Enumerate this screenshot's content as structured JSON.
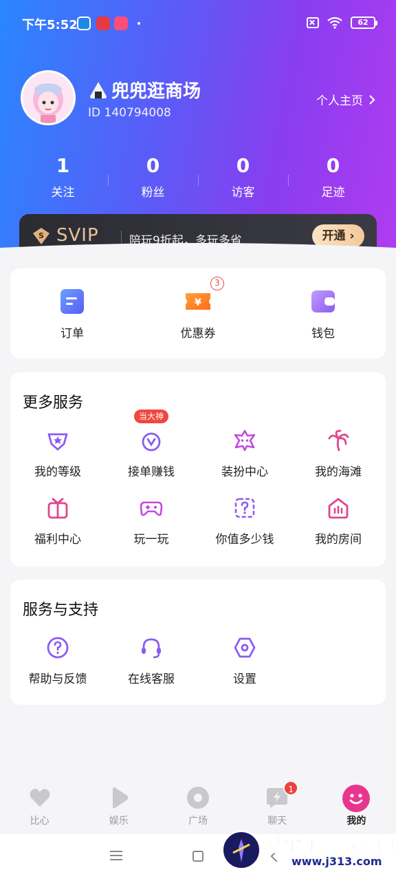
{
  "status_bar": {
    "time": "下午5:52",
    "battery": "62"
  },
  "profile": {
    "nickname": "兜兜逛商场",
    "id_text": "ID 140794008",
    "home_link": "个人主页"
  },
  "stats": [
    {
      "value": "1",
      "label": "关注"
    },
    {
      "value": "0",
      "label": "粉丝"
    },
    {
      "value": "0",
      "label": "访客"
    },
    {
      "value": "0",
      "label": "足迹"
    }
  ],
  "svip": {
    "title": "SVIP",
    "text": "陪玩9折起，多玩多省",
    "button": "开通"
  },
  "quick_actions": [
    {
      "label": "订单",
      "icon": "order-icon",
      "color": "#4f7ef7"
    },
    {
      "label": "优惠券",
      "icon": "coupon-icon",
      "color": "#ff7a1a",
      "badge": "3"
    },
    {
      "label": "钱包",
      "icon": "wallet-icon",
      "color": "#9b6cf5"
    }
  ],
  "more_services": {
    "title": "更多服务",
    "items": [
      {
        "label": "我的等级",
        "icon": "level-icon",
        "color": "#8a5cf0"
      },
      {
        "label": "接单赚钱",
        "icon": "earn-icon",
        "color": "#8a5cf0",
        "tag": "当大神"
      },
      {
        "label": "装扮中心",
        "icon": "dressup-icon",
        "color": "#c14ae0"
      },
      {
        "label": "我的海滩",
        "icon": "beach-icon",
        "color": "#e0458a"
      },
      {
        "label": "福利中心",
        "icon": "gift-icon",
        "color": "#e0458a"
      },
      {
        "label": "玩一玩",
        "icon": "gamepad-icon",
        "color": "#c14ae0"
      },
      {
        "label": "你值多少钱",
        "icon": "question-box-icon",
        "color": "#8a5cf0"
      },
      {
        "label": "我的房间",
        "icon": "room-icon",
        "color": "#e0458a"
      }
    ]
  },
  "support": {
    "title": "服务与支持",
    "items": [
      {
        "label": "帮助与反馈",
        "icon": "help-icon",
        "color": "#8a5cf0"
      },
      {
        "label": "在线客服",
        "icon": "headset-icon",
        "color": "#8a5cf0"
      },
      {
        "label": "设置",
        "icon": "settings-icon",
        "color": "#8a5cf0"
      }
    ]
  },
  "bottom_nav": [
    {
      "label": "比心",
      "icon": "heart-icon"
    },
    {
      "label": "娱乐",
      "icon": "play-icon"
    },
    {
      "label": "广场",
      "icon": "circle-icon"
    },
    {
      "label": "聊天",
      "icon": "chat-icon",
      "badge": "1"
    },
    {
      "label": "我的",
      "icon": "smile-icon",
      "active": true
    }
  ],
  "watermark": {
    "title": "基伞手游资源网",
    "url": "www.j313.com"
  },
  "colors": {
    "accent": "#8a5cf0",
    "pink": "#e0458a",
    "active_nav": "#e8368f"
  }
}
